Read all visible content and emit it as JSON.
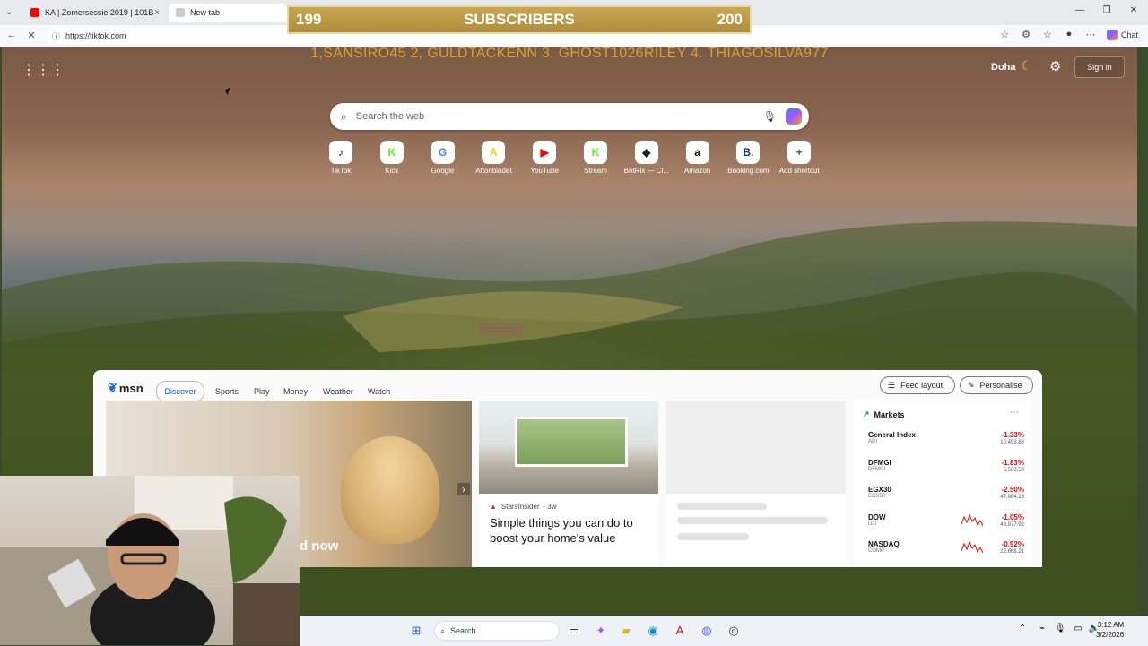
{
  "browser": {
    "tabs": [
      {
        "label": "KA | Zomersessie 2019 | 101Barz ·",
        "close": "×"
      },
      {
        "label": "New tab",
        "close": ""
      }
    ],
    "url": "https://tiktok.com",
    "chat_label": "Chat"
  },
  "overlay": {
    "sub_current": "199",
    "sub_label": "SUBSCRIBERS",
    "sub_goal": "200",
    "ticker": "1,SANSIRO45  2, GULDTACKENN 3. GHOST1026RILEY 4. THIAGOSILVA977"
  },
  "newtab": {
    "city": "Doha",
    "signin": "Sign in",
    "search_placeholder": "Search the web",
    "shortcuts": [
      {
        "label": "TikTok",
        "glyph": "♪",
        "color": "#111111"
      },
      {
        "label": "Kick",
        "glyph": "K",
        "color": "#53fc18"
      },
      {
        "label": "Google",
        "glyph": "G",
        "color": "#4285f4"
      },
      {
        "label": "Aftonbladet",
        "glyph": "A",
        "color": "#f2d500"
      },
      {
        "label": "YouTube",
        "glyph": "▶",
        "color": "#ff0000"
      },
      {
        "label": "Stream",
        "glyph": "K",
        "color": "#53fc18"
      },
      {
        "label": "BotRix — Cl...",
        "glyph": "◆",
        "color": "#222222"
      },
      {
        "label": "Amazon",
        "glyph": "a",
        "color": "#111111"
      },
      {
        "label": "Booking.com",
        "glyph": "B.",
        "color": "#003580"
      },
      {
        "label": "Add shortcut",
        "glyph": "+",
        "color": "#555555"
      }
    ]
  },
  "msn": {
    "logo": "msn",
    "nav": [
      "Discover",
      "Sports",
      "Play",
      "Money",
      "Weather",
      "Watch"
    ],
    "feed_layout": "Feed layout",
    "personalise": "Personalise",
    "card_partial_text": "d now",
    "article": {
      "source": "StarsInsider",
      "age": "3w",
      "title": "Simple things you can do to boost your home's value"
    },
    "markets": {
      "title": "Markets",
      "rows": [
        {
          "name": "General Index",
          "sub": "ADI",
          "change": "-1.33%",
          "value": "10,453.88"
        },
        {
          "name": "DFMGI",
          "sub": "DFMGI",
          "change": "-1.83%",
          "value": "6,503.50"
        },
        {
          "name": "EGX30",
          "sub": "EGX30",
          "change": "-2.50%",
          "value": "47,984.26"
        },
        {
          "name": "DOW",
          "sub": "DJI",
          "change": "-1.05%",
          "value": "48,977.92"
        },
        {
          "name": "NASDAQ",
          "sub": "COMP",
          "change": "-0.92%",
          "value": "22,668.21"
        }
      ]
    }
  },
  "taskbar": {
    "search": "Search",
    "time": "3:12 AM",
    "date": "3/2/2026"
  }
}
